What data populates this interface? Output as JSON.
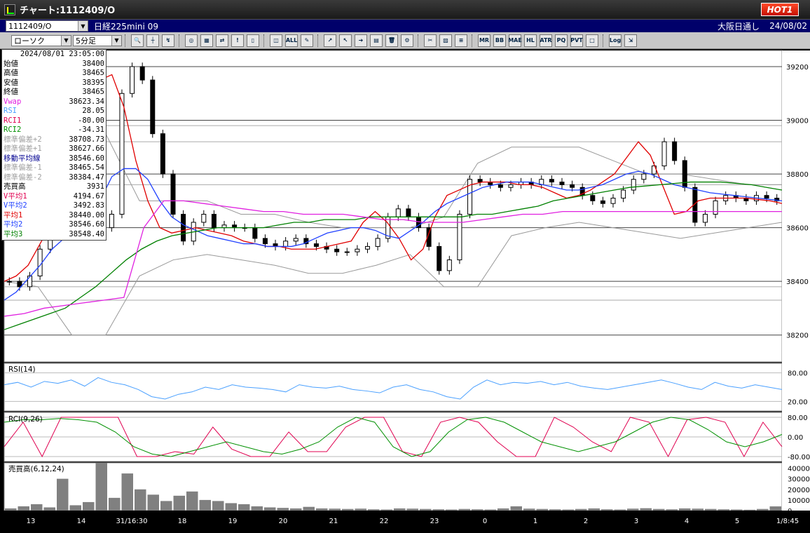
{
  "window": {
    "title": "チャート:1112409/O",
    "hot_label": "HOT1"
  },
  "header": {
    "symbol": "1112409/O",
    "instrument": "日経225mini 09",
    "session": "大阪日通し",
    "date": "24/08/02"
  },
  "toolbar": {
    "chart_type": "ローソク",
    "interval": "5分足",
    "buttons": [
      "search-icon",
      "crosshair-icon",
      "trend-icon",
      "target-icon",
      "grid-icon",
      "overlay-icon",
      "disabled-icon",
      "candle-add-icon",
      "candle-mark-icon",
      "all-icon",
      "pen-icon",
      "line-icon",
      "cursor-icon",
      "arrow-icon",
      "note-icon",
      "delete-icon",
      "gear-icon",
      "tools-icon",
      "color-icon",
      "ma-icon",
      "mr-icon",
      "bb-icon",
      "mae-icon",
      "hl-icon",
      "atr-icon",
      "pq-icon",
      "pvt-icon",
      "box-icon",
      "log-icon",
      "export-icon"
    ],
    "button_labels": {
      "mr": "MR",
      "bb": "BB",
      "mae": "MAE",
      "hl": "HL",
      "atr": "ATR",
      "pq": "PQ",
      "pvt": "PVT",
      "log": "Log",
      "all": "ALL"
    }
  },
  "info": {
    "datetime": "2024/08/01 23:05:00",
    "rows": [
      {
        "label": "始値",
        "value": "38400",
        "color": "#000000"
      },
      {
        "label": "高値",
        "value": "38465",
        "color": "#000000"
      },
      {
        "label": "安値",
        "value": "38395",
        "color": "#000000"
      },
      {
        "label": "終値",
        "value": "38465",
        "color": "#000000"
      },
      {
        "label": "Vwap",
        "value": "38623.34",
        "color": "#e020e0"
      },
      {
        "label": "RSI",
        "value": "28.05",
        "color": "#4aa0ff"
      },
      {
        "label": "RCI1",
        "value": "-80.00",
        "color": "#e00050"
      },
      {
        "label": "RCI2",
        "value": "-34.31",
        "color": "#009000"
      },
      {
        "label": "標準偏差+2",
        "value": "38708.73",
        "color": "#a0a0a0"
      },
      {
        "label": "標準偏差+1",
        "value": "38627.66",
        "color": "#a0a0a0"
      },
      {
        "label": "移動平均線",
        "value": "38546.60",
        "color": "#000090"
      },
      {
        "label": "標準偏差-1",
        "value": "38465.54",
        "color": "#a0a0a0"
      },
      {
        "label": "標準偏差-2",
        "value": "38384.47",
        "color": "#a0a0a0"
      },
      {
        "label": "売買高",
        "value": "3931",
        "color": "#000000"
      },
      {
        "label": "V平均1",
        "value": "4194.67",
        "color": "#e00050"
      },
      {
        "label": "V平均2",
        "value": "3492.83",
        "color": "#2040ff"
      },
      {
        "label": "平均1",
        "value": "38440.00",
        "color": "#e00000"
      },
      {
        "label": "平均2",
        "value": "38546.60",
        "color": "#2040ff"
      },
      {
        "label": "平均3",
        "value": "38548.40",
        "color": "#008000"
      }
    ]
  },
  "panes": {
    "rsi_label": "RSI(14)",
    "rci_label": "RCI(9,26)",
    "vol_label": "売買高(6,12,24)"
  },
  "chart_data": {
    "type": "line",
    "price_axis": {
      "ticks": [
        "39200",
        "39000",
        "38800",
        "38600",
        "38400",
        "38200"
      ],
      "ylim": [
        38100,
        39260
      ]
    },
    "rsi_axis": {
      "ticks": [
        "80.00",
        "20.00"
      ],
      "ylim": [
        0,
        100
      ]
    },
    "rci_axis": {
      "ticks": [
        "80.00",
        "0.00",
        "-80.00"
      ],
      "ylim": [
        -100,
        100
      ]
    },
    "volume_axis": {
      "ticks": [
        "40000",
        "30000",
        "20000",
        "10000",
        "0"
      ],
      "ylim": [
        0,
        45000
      ]
    },
    "x_ticks": [
      "13",
      "14",
      "31/16:30",
      "18",
      "19",
      "20",
      "21",
      "22",
      "23",
      "0",
      "1",
      "2",
      "3",
      "4",
      "5",
      "1/8:45"
    ],
    "price_close": [
      38400,
      38380,
      38420,
      38520,
      38580,
      38620,
      38660,
      38650,
      38640,
      38600,
      38650,
      39100,
      39200,
      39150,
      38950,
      38800,
      38650,
      38550,
      38620,
      38650,
      38600,
      38610,
      38600,
      38600,
      38560,
      38540,
      38530,
      38550,
      38560,
      38540,
      38530,
      38520,
      38510,
      38510,
      38520,
      38530,
      38560,
      38640,
      38670,
      38640,
      38600,
      38530,
      38440,
      38480,
      38650,
      38780,
      38770,
      38760,
      38750,
      38760,
      38770,
      38760,
      38780,
      38770,
      38760,
      38750,
      38720,
      38700,
      38690,
      38710,
      38740,
      38780,
      38800,
      38830,
      38920,
      38850,
      38750,
      38620,
      38650,
      38700,
      38720,
      38710,
      38700,
      38720,
      38710,
      38700
    ],
    "series": [
      {
        "name": "平均1",
        "color": "#e00000",
        "values": [
          38400,
          38420,
          38460,
          38540,
          38620,
          38660,
          38690,
          38700,
          39150,
          39170,
          39050,
          38850,
          38700,
          38600,
          38580,
          38590,
          38600,
          38590,
          38580,
          38570,
          38550,
          38540,
          38530,
          38530,
          38520,
          38520,
          38520,
          38530,
          38540,
          38550,
          38620,
          38660,
          38620,
          38560,
          38480,
          38520,
          38640,
          38720,
          38740,
          38760,
          38770,
          38770,
          38770,
          38760,
          38760,
          38750,
          38730,
          38710,
          38720,
          38740,
          38770,
          38800,
          38860,
          38920,
          38870,
          38760,
          38650,
          38660,
          38700,
          38710,
          38710,
          38710,
          38710,
          38705,
          38700,
          38690
        ]
      },
      {
        "name": "平均2",
        "color": "#2040ff",
        "values": [
          38330,
          38360,
          38410,
          38460,
          38520,
          38560,
          38600,
          38640,
          38700,
          38790,
          38820,
          38820,
          38780,
          38700,
          38640,
          38610,
          38590,
          38570,
          38560,
          38550,
          38540,
          38540,
          38530,
          38530,
          38530,
          38540,
          38560,
          38580,
          38590,
          38600,
          38600,
          38590,
          38570,
          38560,
          38590,
          38620,
          38660,
          38690,
          38710,
          38730,
          38750,
          38760,
          38770,
          38770,
          38770,
          38760,
          38750,
          38740,
          38740,
          38750,
          38760,
          38780,
          38800,
          38810,
          38800,
          38780,
          38760,
          38750,
          38740,
          38730,
          38725,
          38720,
          38715,
          38710,
          38705,
          38700
        ]
      },
      {
        "name": "平均3",
        "color": "#008000",
        "values": [
          38220,
          38240,
          38260,
          38280,
          38300,
          38340,
          38380,
          38430,
          38480,
          38520,
          38550,
          38570,
          38580,
          38590,
          38600,
          38600,
          38600,
          38600,
          38610,
          38620,
          38620,
          38630,
          38630,
          38630,
          38640,
          38640,
          38640,
          38640,
          38640,
          38640,
          38640,
          38650,
          38650,
          38660,
          38670,
          38680,
          38700,
          38710,
          38720,
          38730,
          38740,
          38750,
          38755,
          38760,
          38765,
          38770,
          38770,
          38770,
          38765,
          38760,
          38750,
          38740
        ]
      },
      {
        "name": "Vwap",
        "color": "#e020e0",
        "values": [
          38270,
          38280,
          38300,
          38310,
          38320,
          38330,
          38340,
          38600,
          38700,
          38700,
          38690,
          38680,
          38670,
          38660,
          38660,
          38650,
          38650,
          38650,
          38640,
          38630,
          38630,
          38620,
          38620,
          38620,
          38630,
          38640,
          38650,
          38650,
          38660,
          38660,
          38660,
          38660,
          38660,
          38660,
          38660,
          38660,
          38660,
          38660,
          38660,
          38660
        ]
      },
      {
        "name": "RSI",
        "color": "#4aa0ff",
        "values": [
          55,
          60,
          50,
          62,
          58,
          65,
          52,
          70,
          60,
          55,
          45,
          30,
          25,
          35,
          40,
          50,
          45,
          55,
          50,
          48,
          45,
          40,
          55,
          50,
          48,
          52,
          45,
          42,
          38,
          50,
          55,
          45,
          40,
          30,
          25,
          50,
          65,
          55,
          60,
          58,
          62,
          55,
          60,
          52,
          48,
          45,
          50,
          55,
          60,
          65,
          58,
          50,
          45,
          60,
          52,
          48,
          55,
          50,
          45
        ]
      },
      {
        "name": "RCI1",
        "color": "#e00050",
        "values": [
          -40,
          60,
          -80,
          80,
          80,
          80,
          80,
          -80,
          -80,
          -60,
          -70,
          40,
          -50,
          -80,
          -80,
          20,
          -60,
          -60,
          40,
          80,
          80,
          -60,
          -80,
          60,
          80,
          60,
          -20,
          -80,
          -80,
          80,
          40,
          -20,
          -60,
          80,
          60,
          -80,
          70,
          80,
          60,
          -80,
          60,
          -40
        ]
      },
      {
        "name": "RCI2",
        "color": "#009000",
        "values": [
          60,
          70,
          70,
          75,
          70,
          60,
          20,
          -40,
          -70,
          -80,
          -60,
          -40,
          -20,
          -40,
          -60,
          -70,
          -50,
          -20,
          40,
          80,
          60,
          -40,
          -80,
          -60,
          20,
          70,
          80,
          60,
          20,
          -20,
          -40,
          -60,
          -40,
          -20,
          20,
          60,
          80,
          70,
          30,
          -20,
          -40,
          -20,
          10
        ]
      }
    ],
    "volume": [
      2000,
      4000,
      6000,
      3000,
      30000,
      5000,
      8000,
      45000,
      12000,
      35000,
      20000,
      15000,
      9000,
      14000,
      18000,
      10000,
      9000,
      7000,
      6000,
      4000,
      3000,
      2500,
      2000,
      3500,
      2000,
      1800,
      1500,
      1800,
      1200,
      1000,
      2000,
      1800,
      1500,
      1200,
      1000,
      1500,
      1200,
      1000,
      2000,
      4000,
      1800,
      1500,
      1200,
      1000,
      1500,
      2000,
      1200,
      1000,
      1800,
      2200,
      1500,
      1200,
      2000,
      1800,
      1500,
      1200,
      1000,
      800,
      1500,
      3931
    ]
  }
}
